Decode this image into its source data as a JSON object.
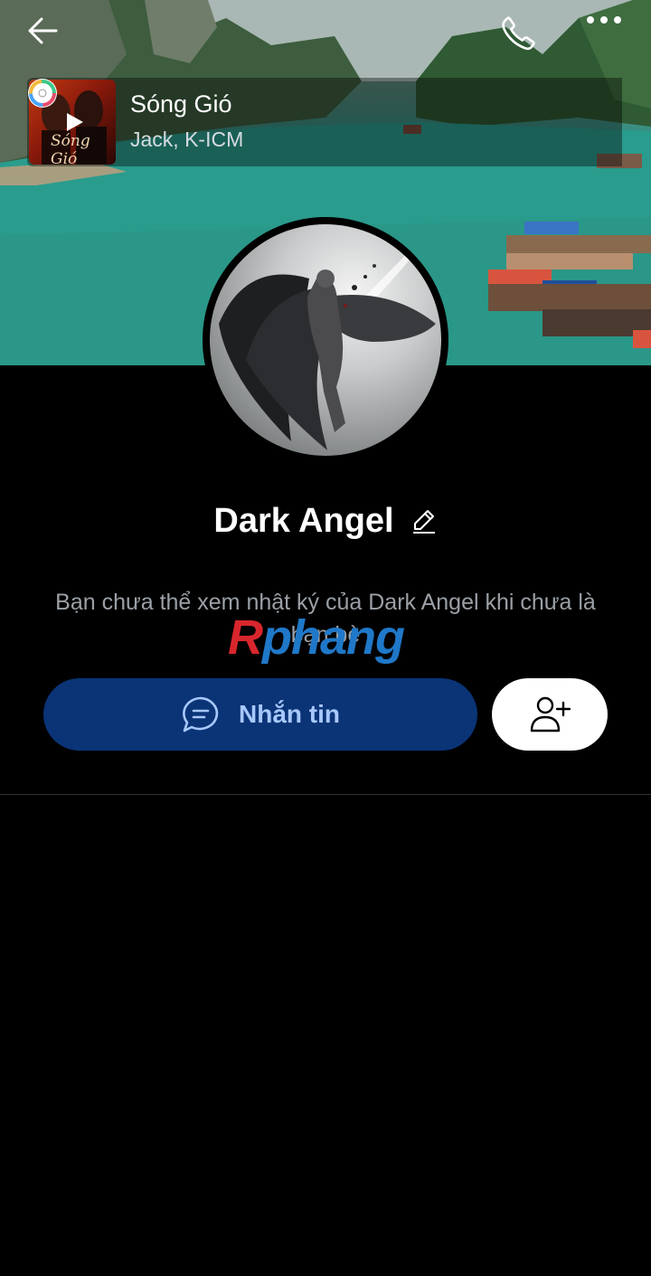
{
  "header": {
    "back_icon": "arrow-left-icon",
    "call_icon": "phone-icon",
    "more_icon": "more-horizontal-icon"
  },
  "music": {
    "title": "Sóng Gió",
    "artist": "Jack, K-ICM",
    "album_art_text": "Sóng Gió",
    "play_icon": "play-icon",
    "disc_icon": "music-disc-icon"
  },
  "profile": {
    "name": "Dark Angel",
    "edit_icon": "pencil-icon",
    "notice": "Bạn chưa thể xem nhật ký của Dark Angel khi chưa là bạn bè"
  },
  "watermark": {
    "part1": "R",
    "part2": "phang"
  },
  "actions": {
    "message_label": "Nhắn tin",
    "message_icon": "chat-bubble-icon",
    "add_friend_icon": "add-user-icon"
  },
  "colors": {
    "background": "#000000",
    "message_button": "#0a3476",
    "message_text": "#a8c8ff",
    "notice_text": "#9aa0a6"
  }
}
